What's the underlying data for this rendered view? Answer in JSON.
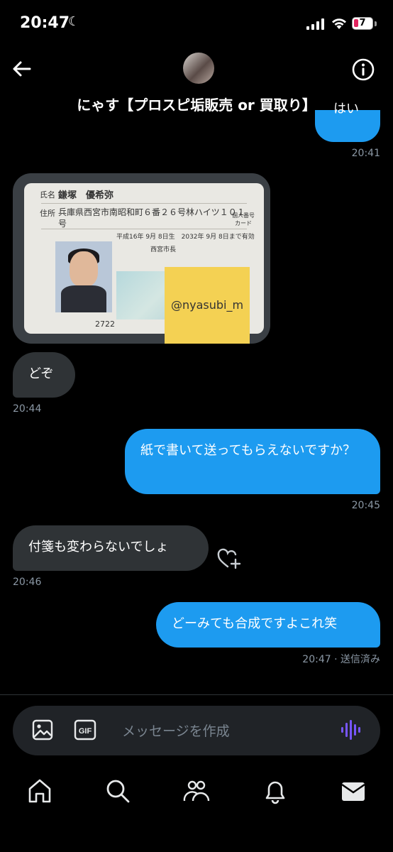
{
  "status_bar": {
    "time": "20:47",
    "battery_level": "7"
  },
  "header": {
    "title": "にゃす【プロスピ垢販売 or 買取り】"
  },
  "messages": {
    "top_bubble_text": "はい",
    "top_time": "20:41",
    "id_card": {
      "name_label": "氏名",
      "name": "鎌塚　優希弥",
      "address_label": "住所",
      "address": "兵庫県西宮市南昭和町６番２６号林ハイツ１０１",
      "address2": "号",
      "dates": "平成16年 9月 8日生　2032年 9月 8日まで有効",
      "issuer": "西宮市長",
      "badge": "個人番号カード",
      "number": "2722",
      "sticky_note": "@nyasubi_m"
    },
    "m1": {
      "text": "どぞ",
      "time": "20:44"
    },
    "m2": {
      "text": "紙で書いて送ってもらえないですか？",
      "time": "20:45"
    },
    "m3": {
      "text": "付箋も変わらないでしょ",
      "time": "20:46"
    },
    "m4": {
      "text": "どーみても合成ですよこれ笑",
      "time": "20:47 · 送信済み"
    }
  },
  "composer": {
    "placeholder": "メッセージを作成",
    "gif_label": "GIF"
  },
  "colors": {
    "accent": "#1d9bf0",
    "incoming": "#2f3336",
    "voice": "#7856ff"
  },
  "icons": {
    "header": [
      "back-arrow-icon",
      "info-icon"
    ],
    "composer": [
      "image-icon",
      "gif-icon",
      "voice-icon"
    ],
    "tabs": [
      "home-icon",
      "search-icon",
      "communities-icon",
      "notifications-icon",
      "messages-icon"
    ]
  }
}
